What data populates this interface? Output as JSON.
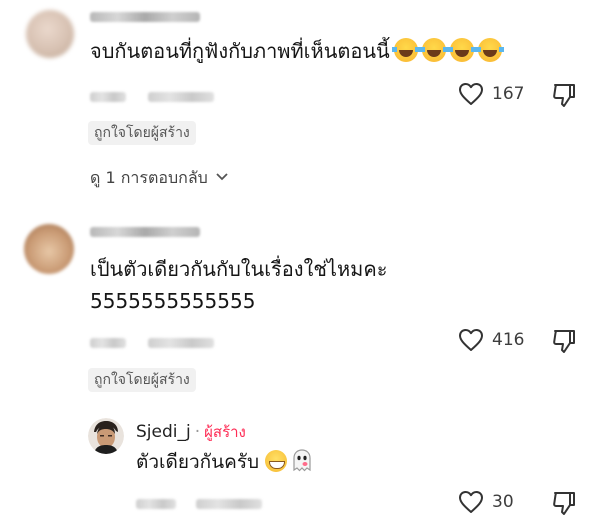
{
  "comments": [
    {
      "text": "จบกันตอนที่กูฟังกับภาพที่เห็นตอนนี้",
      "emoji_count": 4,
      "likes": "167",
      "creator_badge": "ถูกใจโดยผู้สร้าง",
      "replies_label": "ดู 1 การตอบกลับ"
    },
    {
      "text_line1": "เป็นตัวเดียวกันกับในเรื่องใช่ไหมคะ",
      "text_line2": "5555555555555",
      "likes": "416",
      "creator_badge": "ถูกใจโดยผู้สร้าง"
    }
  ],
  "reply": {
    "username": "Sjedi_j",
    "separator": "·",
    "creator_label": "ผู้สร้าง",
    "text": "ตัวเดียวกันครับ",
    "likes": "30"
  },
  "icons": {
    "like": "heart-outline-icon",
    "dislike": "thumb-down-outline-icon",
    "expand": "chevron-down-icon"
  },
  "colors": {
    "accent": "#fe2c55",
    "text": "#161616",
    "muted": "#8a8a8a"
  }
}
